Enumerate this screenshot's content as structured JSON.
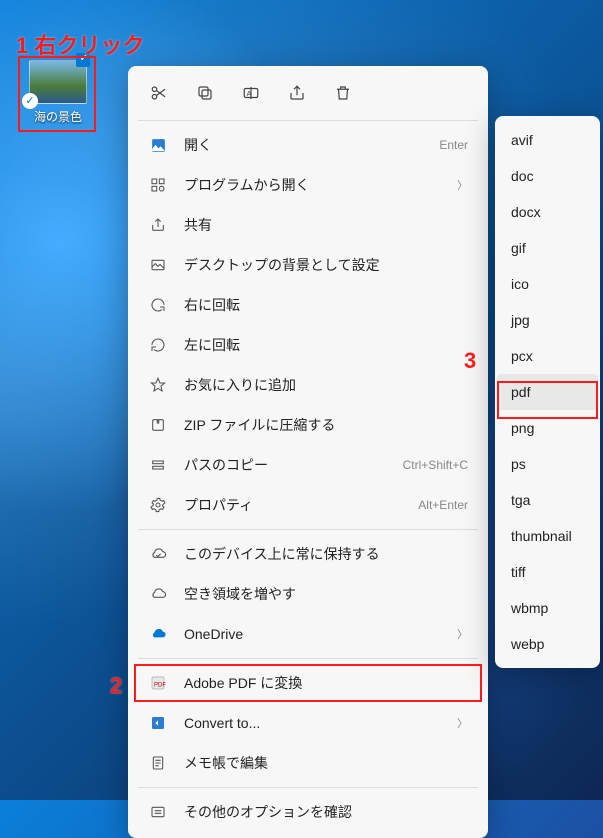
{
  "annotations": {
    "step1": "1 右クリック",
    "step2": "2",
    "step3": "3"
  },
  "desktopIcon": {
    "label": "海の景色"
  },
  "topActions": {
    "cut": "cut",
    "copy": "copy",
    "rename": "rename",
    "share": "share",
    "delete": "delete"
  },
  "menu": {
    "open": {
      "label": "開く",
      "hint": "Enter"
    },
    "openWith": {
      "label": "プログラムから開く"
    },
    "share": {
      "label": "共有"
    },
    "setBg": {
      "label": "デスクトップの背景として設定"
    },
    "rotateRight": {
      "label": "右に回転"
    },
    "rotateLeft": {
      "label": "左に回転"
    },
    "favorite": {
      "label": "お気に入りに追加"
    },
    "zip": {
      "label": "ZIP ファイルに圧縮する"
    },
    "copyPath": {
      "label": "パスのコピー",
      "hint": "Ctrl+Shift+C"
    },
    "properties": {
      "label": "プロパティ",
      "hint": "Alt+Enter"
    },
    "keepDevice": {
      "label": "このデバイス上に常に保持する"
    },
    "freeSpace": {
      "label": "空き領域を増やす"
    },
    "onedrive": {
      "label": "OneDrive"
    },
    "adobePdf": {
      "label": "Adobe PDF に変換"
    },
    "convertTo": {
      "label": "Convert to..."
    },
    "notepad": {
      "label": "メモ帳で編集"
    },
    "moreOptions": {
      "label": "その他のオプションを確認"
    }
  },
  "submenu": {
    "items": [
      "avif",
      "doc",
      "docx",
      "gif",
      "ico",
      "jpg",
      "pcx",
      "pdf",
      "png",
      "ps",
      "tga",
      "thumbnail",
      "tiff",
      "wbmp",
      "webp"
    ],
    "selected": "pdf"
  }
}
